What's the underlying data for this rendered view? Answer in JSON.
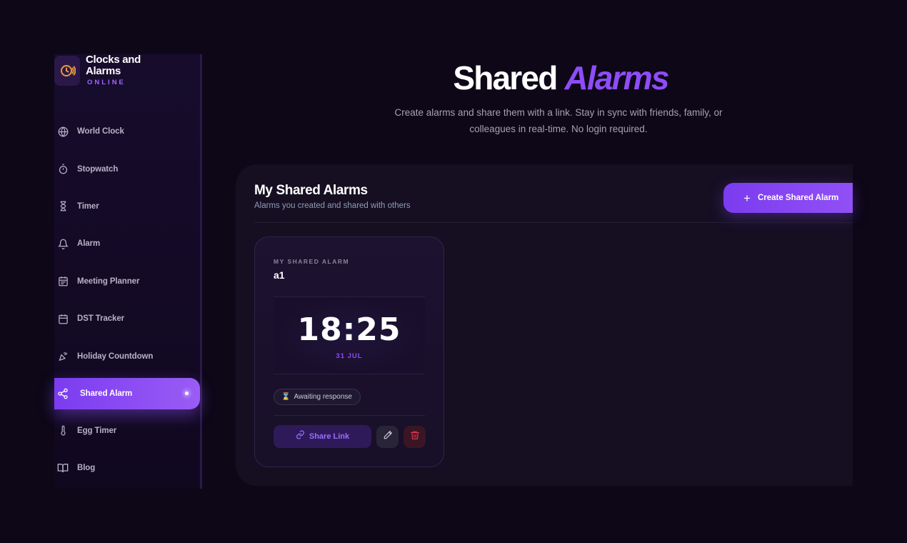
{
  "brand": {
    "title": "Clocks and Alarms",
    "subtitle": "ONLINE",
    "logo_icon": "clock-alarm-icon"
  },
  "sidebar": {
    "items": [
      {
        "label": "World Clock",
        "icon": "globe-icon"
      },
      {
        "label": "Stopwatch",
        "icon": "stopwatch-icon"
      },
      {
        "label": "Timer",
        "icon": "hourglass-icon"
      },
      {
        "label": "Alarm",
        "icon": "bell-icon"
      },
      {
        "label": "Meeting Planner",
        "icon": "calendar-list-icon"
      },
      {
        "label": "DST Tracker",
        "icon": "calendar-icon"
      },
      {
        "label": "Holiday Countdown",
        "icon": "party-popper-icon"
      },
      {
        "label": "Shared Alarm",
        "icon": "share-icon",
        "active": true
      },
      {
        "label": "Egg Timer",
        "icon": "thermometer-icon"
      },
      {
        "label": "Blog",
        "icon": "book-icon"
      }
    ]
  },
  "header": {
    "title_main": "Shared",
    "title_accent": "Alarms",
    "subtitle": "Create alarms and share them with a link. Stay in sync with friends, family, or colleagues in real-time. No login required."
  },
  "panel": {
    "title": "My Shared Alarms",
    "description": "Alarms you created and shared with others",
    "create_label": "Create Shared Alarm"
  },
  "card": {
    "kicker": "MY SHARED ALARM",
    "name": "a1",
    "time": "18:25",
    "date": "31 JUL",
    "status": "Awaiting response",
    "share_label": "Share Link"
  },
  "colors": {
    "accent": "#8f4cf7",
    "background": "#0d0717",
    "panel": "#160f22",
    "danger": "#e0344f"
  }
}
